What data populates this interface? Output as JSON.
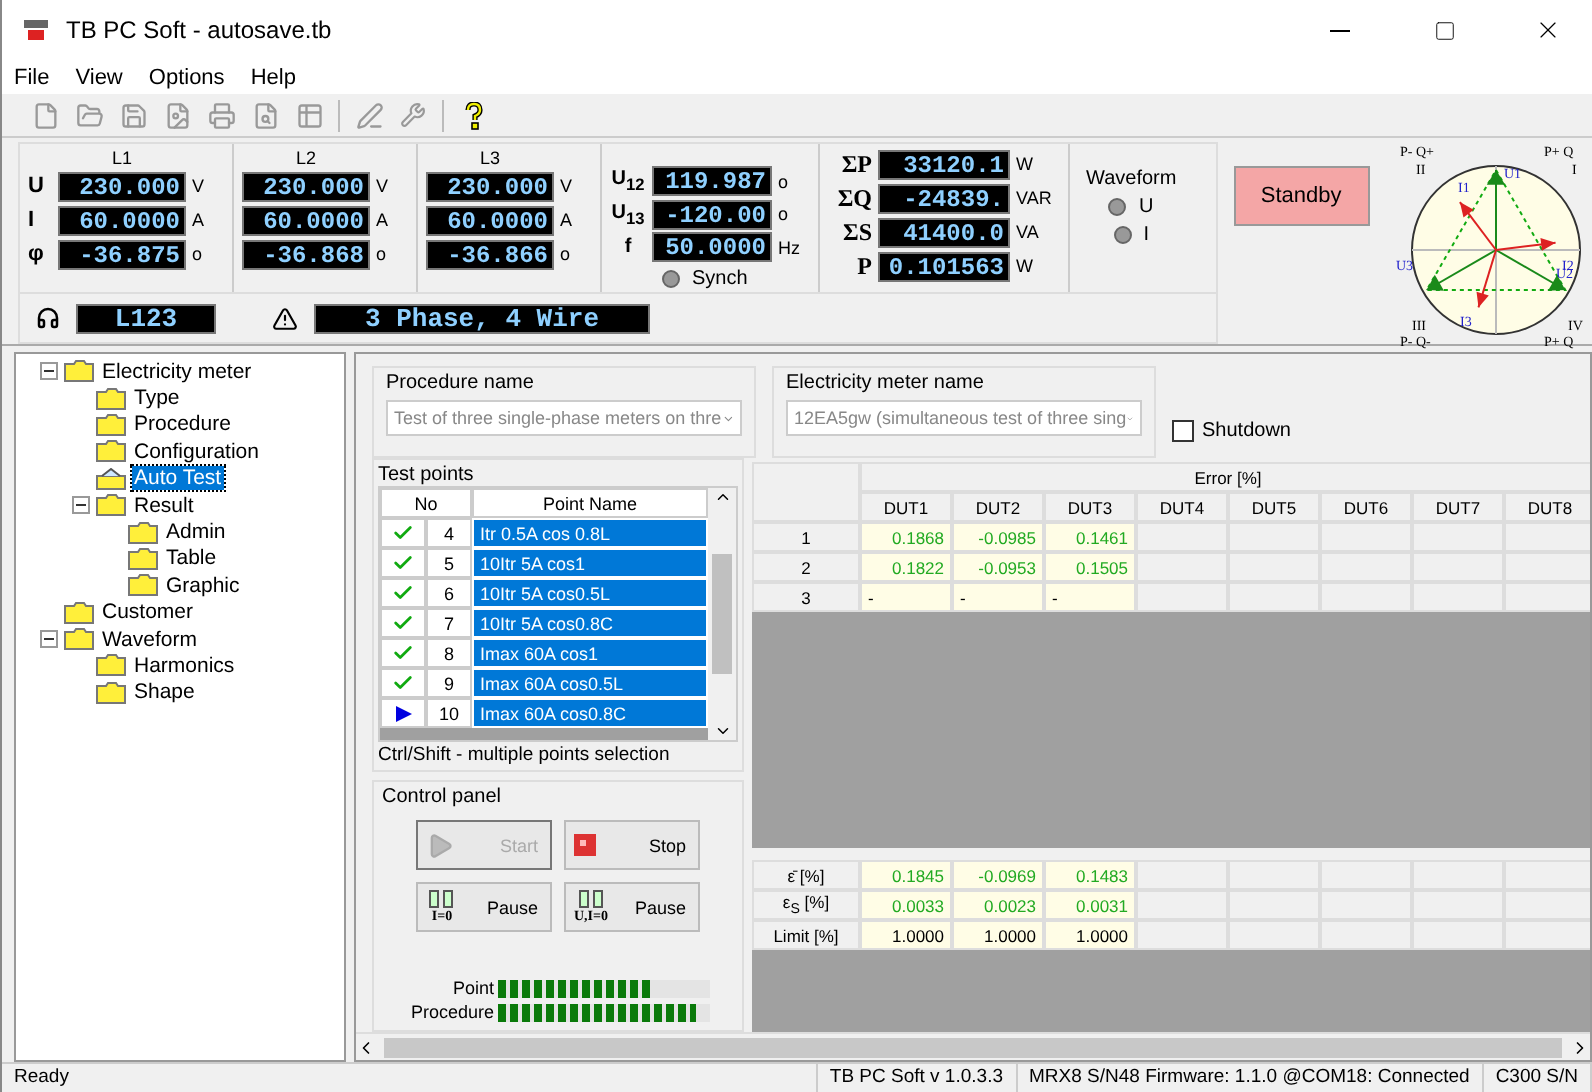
{
  "window": {
    "title": "TB PC Soft - autosave.tb"
  },
  "menu": [
    "File",
    "View",
    "Options",
    "Help"
  ],
  "measurements": {
    "row_labels": [
      "U",
      "I",
      "φ"
    ],
    "phases": [
      {
        "name": "L1",
        "values": [
          "230.000",
          "60.0000",
          "-36.875"
        ],
        "units": [
          "V",
          "A",
          "o"
        ]
      },
      {
        "name": "L2",
        "values": [
          "230.000",
          "60.0000",
          "-36.868"
        ],
        "units": [
          "V",
          "A",
          "o"
        ]
      },
      {
        "name": "L3",
        "values": [
          "230.000",
          "60.0000",
          "-36.866"
        ],
        "units": [
          "V",
          "A",
          "o"
        ]
      }
    ],
    "angles": [
      {
        "label": "U$_{12}$",
        "value": "119.987",
        "unit": "o"
      },
      {
        "label": "U$_{13}$",
        "value": "-120.00",
        "unit": "o"
      },
      {
        "label": "f",
        "value": "50.0000",
        "unit": "Hz"
      }
    ],
    "synch": {
      "label": "Synch",
      "on": false
    },
    "totals": [
      {
        "label": "ΣP",
        "value": "33120.1",
        "unit": "W"
      },
      {
        "label": "ΣQ",
        "value": "-24839.",
        "unit": "VAR"
      },
      {
        "label": "ΣS",
        "value": "41400.0",
        "unit": "VA"
      },
      {
        "label": "P",
        "value": "0.101563",
        "unit": "W"
      }
    ],
    "phase_sequence": "L123",
    "connection": "3 Phase, 4 Wire"
  },
  "waveform": {
    "title": "Waveform",
    "options": [
      {
        "label": "U",
        "on": false
      },
      {
        "label": "I",
        "on": false
      }
    ]
  },
  "standby_button": "Standby",
  "phasor": {
    "quadrants": [
      {
        "sign": "P- Q+",
        "roman": "II"
      },
      {
        "sign": "P+ Q",
        "roman": "I"
      },
      {
        "sign": "P- Q-",
        "roman": "III"
      },
      {
        "sign": "P+ Q",
        "roman": "IV"
      }
    ],
    "vectors": [
      "U1",
      "U2",
      "U3",
      "I1",
      "I2",
      "I3"
    ]
  },
  "tree": [
    {
      "label": "Electricity meter",
      "kind": "folder",
      "selected": false,
      "expanded": true,
      "children": [
        {
          "label": "Type",
          "kind": "folder",
          "selected": false
        },
        {
          "label": "Procedure",
          "kind": "folder",
          "selected": false
        },
        {
          "label": "Configuration",
          "kind": "folder",
          "selected": false
        },
        {
          "label": "Auto Test",
          "kind": "auto",
          "selected": true
        },
        {
          "label": "Result",
          "kind": "folder",
          "selected": false,
          "expanded": true,
          "children": [
            {
              "label": "Admin",
              "kind": "folder",
              "selected": false
            },
            {
              "label": "Table",
              "kind": "folder",
              "selected": false
            },
            {
              "label": "Graphic",
              "kind": "folder",
              "selected": false
            }
          ]
        }
      ]
    },
    {
      "label": "Customer",
      "kind": "folder",
      "selected": false
    },
    {
      "label": "Waveform",
      "kind": "folder",
      "selected": false,
      "expanded": true,
      "children": [
        {
          "label": "Harmonics",
          "kind": "folder",
          "selected": false
        },
        {
          "label": "Shape",
          "kind": "folder",
          "selected": false
        }
      ]
    }
  ],
  "procedure": {
    "label": "Procedure name",
    "value": "Test of three single-phase meters on thre"
  },
  "meter": {
    "label": "Electricity meter name",
    "value": "12EA5gw (simultaneous test of three sing"
  },
  "shutdown": {
    "label": "Shutdown",
    "checked": false
  },
  "test_points": {
    "title": "Test points",
    "columns": [
      "No",
      "Point Name"
    ],
    "rows": [
      {
        "kind": "done",
        "no": "4",
        "name": "Itr 0.5A cos 0.8L",
        "selected": true
      },
      {
        "kind": "done",
        "no": "5",
        "name": "10Itr 5A cos1",
        "selected": true
      },
      {
        "kind": "done",
        "no": "6",
        "name": "10Itr 5A cos0.5L",
        "selected": true
      },
      {
        "kind": "done",
        "no": "7",
        "name": "10Itr 5A cos0.8C",
        "selected": true
      },
      {
        "kind": "done",
        "no": "8",
        "name": "Imax 60A cos1",
        "selected": true
      },
      {
        "kind": "done",
        "no": "9",
        "name": "Imax 60A cos0.5L",
        "selected": true
      },
      {
        "kind": "current",
        "no": "10",
        "name": "Imax 60A cos0.8C",
        "selected": true
      }
    ],
    "hint": "Ctrl/Shift - multiple points selection"
  },
  "control_panel": {
    "title": "Control panel",
    "buttons": [
      {
        "kind": "start",
        "label": "Start",
        "disabled": true
      },
      {
        "kind": "stop",
        "label": "Stop",
        "disabled": false
      },
      {
        "kind": "pause",
        "label": "Pause",
        "sub": "I=0",
        "disabled": false
      },
      {
        "kind": "pause",
        "label": "Pause",
        "sub": "U,I=0",
        "disabled": false
      }
    ],
    "progress": [
      {
        "label": "Point",
        "level": 0.72
      },
      {
        "label": "Procedure",
        "level": 0.93
      }
    ]
  },
  "results": {
    "group": "Error [%]",
    "columns": [
      "DUT1",
      "DUT2",
      "DUT3",
      "DUT4",
      "DUT5",
      "DUT6",
      "DUT7",
      "DUT8"
    ],
    "rows": [
      {
        "label": "1",
        "cells": [
          "0.1868",
          "-0.0985",
          "0.1461"
        ]
      },
      {
        "label": "2",
        "cells": [
          "0.1822",
          "-0.0953",
          "0.1505"
        ]
      },
      {
        "label": "3",
        "cells": [
          "-",
          "-",
          "-"
        ]
      }
    ],
    "summary": [
      {
        "label": "ε̄ [%]",
        "kind": "result",
        "cells": [
          "0.1845",
          "-0.0969",
          "0.1483"
        ]
      },
      {
        "label": "ε$_{S}$ [%]",
        "kind": "result",
        "cells": [
          "0.0033",
          "0.0023",
          "0.0031"
        ]
      },
      {
        "label": "Limit [%]",
        "kind": "limit",
        "cells": [
          "1.0000",
          "1.0000",
          "1.0000"
        ]
      }
    ]
  },
  "status_bar": [
    "Ready",
    "TB PC Soft v 1.0.3.3",
    "MRX8 S/N48 Firmware: 1.1.0 @COM18: Connected",
    "C300 S/N"
  ]
}
